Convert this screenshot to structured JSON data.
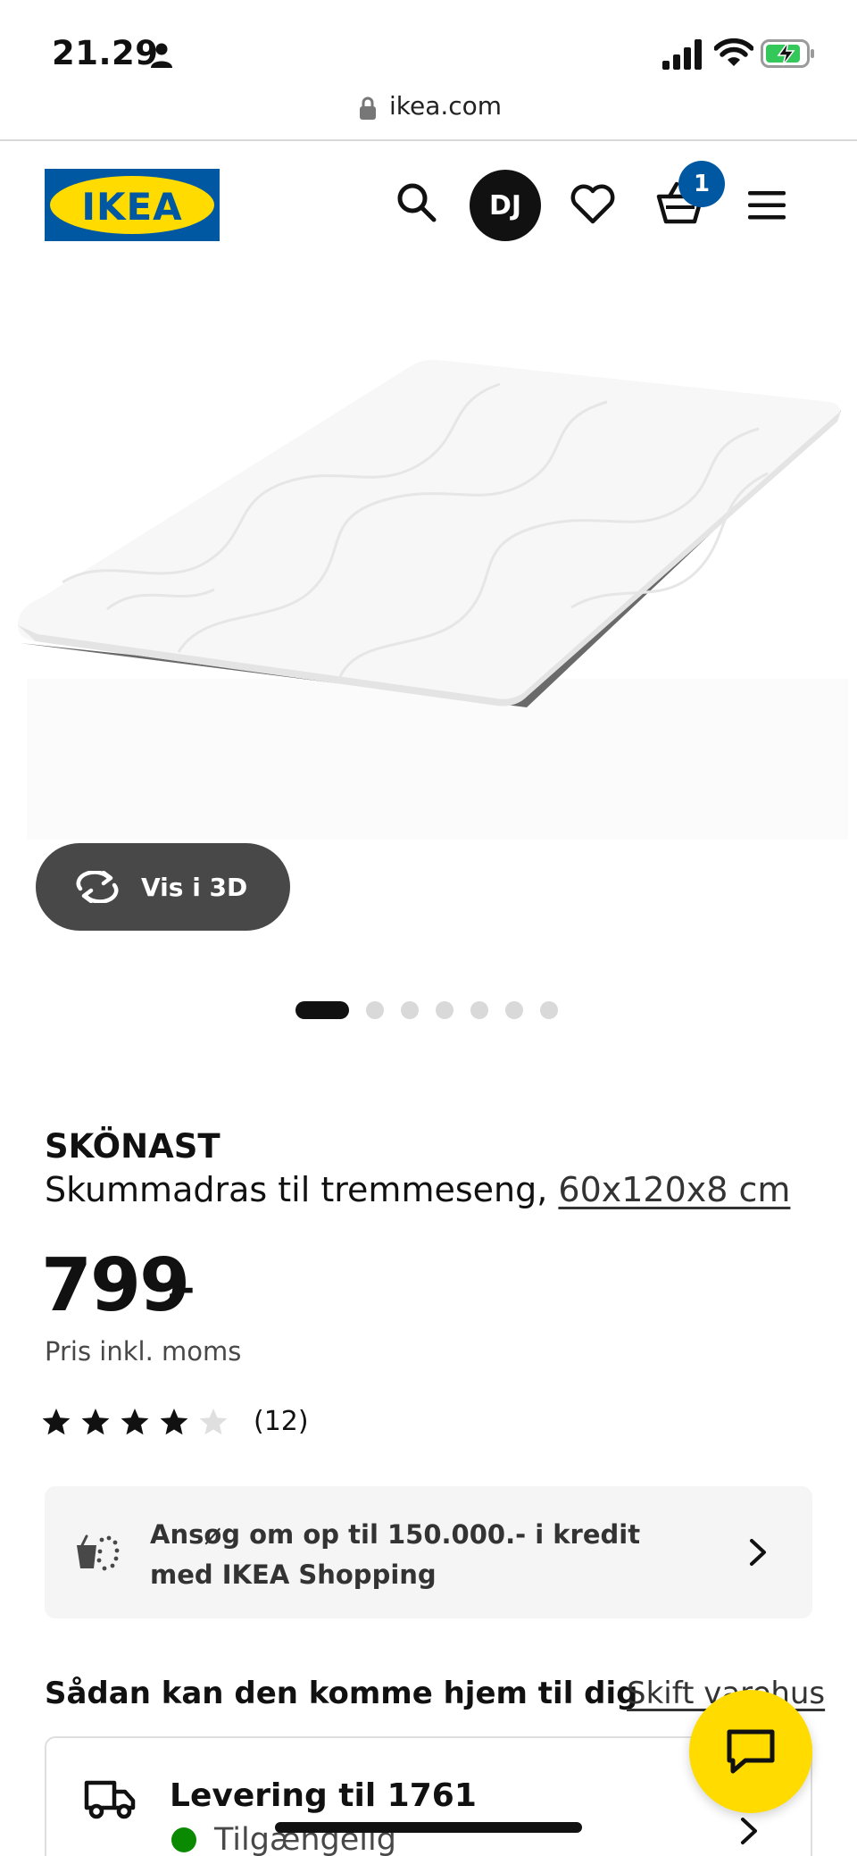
{
  "status_bar": {
    "time": "21.29"
  },
  "browser": {
    "url": "ikea.com"
  },
  "header": {
    "logo_text": "IKEA",
    "profile_initials": "DJ",
    "cart_count": "1",
    "brand_blue": "#0058a3",
    "brand_yellow": "#ffdb00",
    "icons": [
      "search-icon",
      "heart-icon",
      "basket-icon",
      "menu-icon"
    ]
  },
  "gallery": {
    "view_3d_label": "Vis i 3D",
    "slide_count": 7,
    "active_slide": 1
  },
  "product": {
    "name": "SKÖNAST",
    "description": "Skummadras til tremmeseng,",
    "size_link": "60x120x8 cm",
    "price": "799",
    "price_suffix": ".-",
    "price_note": "Pris inkl. moms",
    "rating": 4,
    "rating_max": 5,
    "review_count": "(12)"
  },
  "credit_banner": {
    "text": "Ansøg om op til 150.000.- i kredit med IKEA Shopping"
  },
  "delivery": {
    "heading": "Sådan kan den komme hjem til dig",
    "change_store": "Skift varehus",
    "title": "Levering til 1761",
    "status": "Tilgængelig",
    "status_color": "#0a8a00"
  }
}
